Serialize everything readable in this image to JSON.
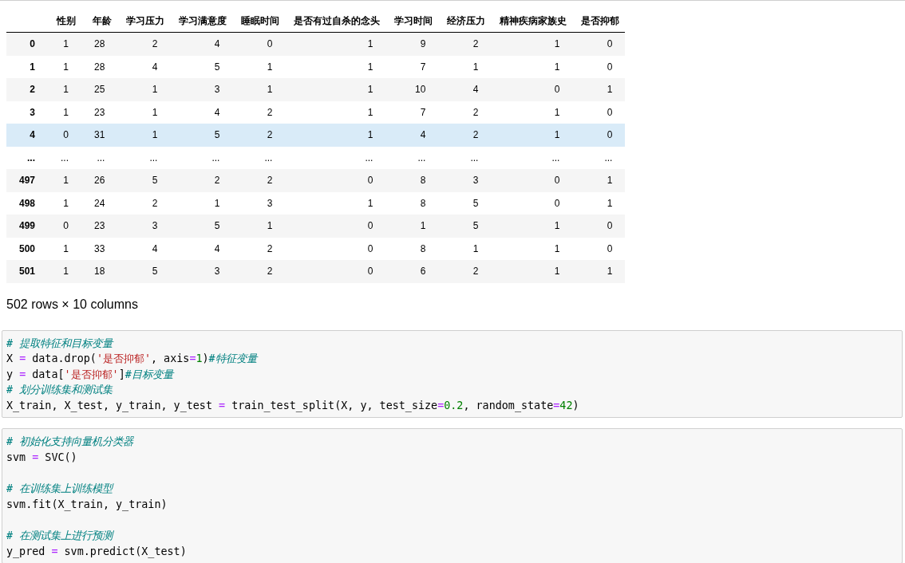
{
  "table": {
    "columns": [
      "性别",
      "年龄",
      "学习压力",
      "学习满意度",
      "睡眠时间",
      "是否有过自杀的念头",
      "学习时间",
      "经济压力",
      "精神疾病家族史",
      "是否抑郁"
    ],
    "rows": [
      {
        "index": "0",
        "selected": false,
        "cells": [
          "1",
          "28",
          "2",
          "4",
          "0",
          "1",
          "9",
          "2",
          "1",
          "0"
        ]
      },
      {
        "index": "1",
        "selected": false,
        "cells": [
          "1",
          "28",
          "4",
          "5",
          "1",
          "1",
          "7",
          "1",
          "1",
          "0"
        ]
      },
      {
        "index": "2",
        "selected": false,
        "cells": [
          "1",
          "25",
          "1",
          "3",
          "1",
          "1",
          "10",
          "4",
          "0",
          "1"
        ]
      },
      {
        "index": "3",
        "selected": false,
        "cells": [
          "1",
          "23",
          "1",
          "4",
          "2",
          "1",
          "7",
          "2",
          "1",
          "0"
        ]
      },
      {
        "index": "4",
        "selected": true,
        "cells": [
          "0",
          "31",
          "1",
          "5",
          "2",
          "1",
          "4",
          "2",
          "1",
          "0"
        ]
      },
      {
        "index": "...",
        "selected": false,
        "cells": [
          "...",
          "...",
          "...",
          "...",
          "...",
          "...",
          "...",
          "...",
          "...",
          "..."
        ]
      },
      {
        "index": "497",
        "selected": false,
        "cells": [
          "1",
          "26",
          "5",
          "2",
          "2",
          "0",
          "8",
          "3",
          "0",
          "1"
        ]
      },
      {
        "index": "498",
        "selected": false,
        "cells": [
          "1",
          "24",
          "2",
          "1",
          "3",
          "1",
          "8",
          "5",
          "0",
          "1"
        ]
      },
      {
        "index": "499",
        "selected": false,
        "cells": [
          "0",
          "23",
          "3",
          "5",
          "1",
          "0",
          "1",
          "5",
          "1",
          "0"
        ]
      },
      {
        "index": "500",
        "selected": false,
        "cells": [
          "1",
          "33",
          "4",
          "4",
          "2",
          "0",
          "8",
          "1",
          "1",
          "0"
        ]
      },
      {
        "index": "501",
        "selected": false,
        "cells": [
          "1",
          "18",
          "5",
          "3",
          "2",
          "0",
          "6",
          "2",
          "1",
          "1"
        ]
      }
    ]
  },
  "shape_note": "502 rows × 10 columns",
  "code_cells": [
    {
      "lines": [
        [
          {
            "kind": "comment",
            "text": "# 提取特征和目标变量"
          }
        ],
        [
          {
            "kind": "text",
            "text": "X "
          },
          {
            "kind": "op",
            "text": "="
          },
          {
            "kind": "text",
            "text": " data.drop("
          },
          {
            "kind": "str",
            "text": "'是否抑郁'"
          },
          {
            "kind": "text",
            "text": ", axis"
          },
          {
            "kind": "op",
            "text": "="
          },
          {
            "kind": "num",
            "text": "1"
          },
          {
            "kind": "text",
            "text": ")"
          },
          {
            "kind": "comment",
            "text": "#特征变量"
          }
        ],
        [
          {
            "kind": "text",
            "text": "y "
          },
          {
            "kind": "op",
            "text": "="
          },
          {
            "kind": "text",
            "text": " data["
          },
          {
            "kind": "str",
            "text": "'是否抑郁'"
          },
          {
            "kind": "text",
            "text": "]"
          },
          {
            "kind": "comment",
            "text": "#目标变量"
          }
        ],
        [
          {
            "kind": "comment",
            "text": "# 划分训练集和测试集"
          }
        ],
        [
          {
            "kind": "text",
            "text": "X_train, X_test, y_train, y_test "
          },
          {
            "kind": "op",
            "text": "="
          },
          {
            "kind": "text",
            "text": " train_test_split(X, y, test_size"
          },
          {
            "kind": "op",
            "text": "="
          },
          {
            "kind": "num",
            "text": "0.2"
          },
          {
            "kind": "text",
            "text": ", random_state"
          },
          {
            "kind": "op",
            "text": "="
          },
          {
            "kind": "num",
            "text": "42"
          },
          {
            "kind": "text",
            "text": ")"
          }
        ]
      ]
    },
    {
      "lines": [
        [
          {
            "kind": "comment",
            "text": "# 初始化支持向量机分类器"
          }
        ],
        [
          {
            "kind": "text",
            "text": "svm "
          },
          {
            "kind": "op",
            "text": "="
          },
          {
            "kind": "text",
            "text": " SVC()"
          }
        ],
        [
          {
            "kind": "blank"
          }
        ],
        [
          {
            "kind": "comment",
            "text": "# 在训练集上训练模型"
          }
        ],
        [
          {
            "kind": "text",
            "text": "svm.fit(X_train, y_train)"
          }
        ],
        [
          {
            "kind": "blank"
          }
        ],
        [
          {
            "kind": "comment",
            "text": "# 在测试集上进行预测"
          }
        ],
        [
          {
            "kind": "text",
            "text": "y_pred "
          },
          {
            "kind": "op",
            "text": "="
          },
          {
            "kind": "text",
            "text": " svm.predict(X_test)"
          }
        ]
      ]
    }
  ]
}
